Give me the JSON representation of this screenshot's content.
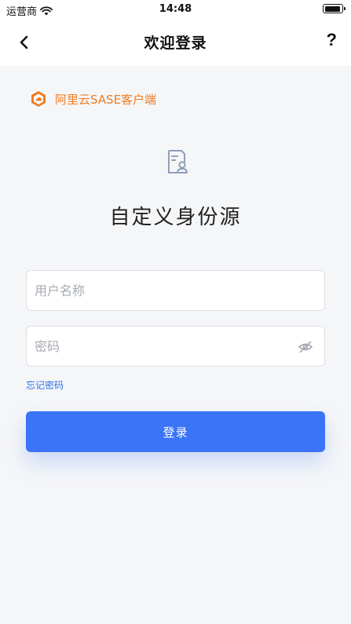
{
  "status_bar": {
    "carrier": "运营商",
    "time": "14:48"
  },
  "nav": {
    "title": "欢迎登录",
    "help": "?"
  },
  "brand": {
    "name": "阿里云SASE客户端",
    "color": "#f07c21"
  },
  "identity": {
    "title": "自定义身份源"
  },
  "form": {
    "username_placeholder": "用户名称",
    "password_placeholder": "密码",
    "forgot_password": "忘记密码",
    "login_label": "登录"
  },
  "colors": {
    "accent": "#3b74f6",
    "link": "#2f6fe8",
    "brand": "#f07c21"
  }
}
